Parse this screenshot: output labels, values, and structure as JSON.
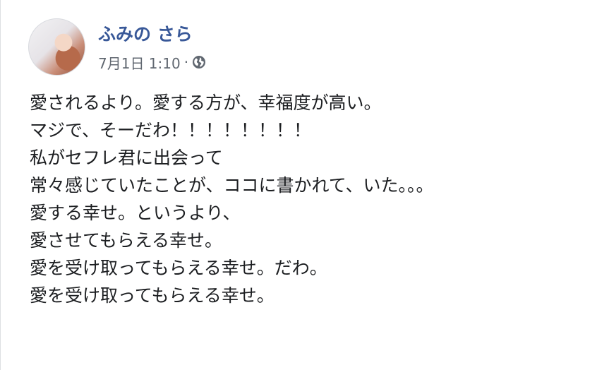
{
  "post": {
    "author_name": "ふみの さら",
    "timestamp": "7月1日 1:10",
    "separator": "·",
    "privacy_icon": "globe-icon",
    "lines": [
      "愛されるより。愛する方が、幸福度が高い。",
      "マジで、そーだわ！！！！！！！！",
      "私がセフレ君に出会って",
      "常々感じていたことが、ココに書かれて、いた。。。",
      "愛する幸せ。というより、",
      "愛させてもらえる幸せ。",
      "愛を受け取ってもらえる幸せ。だわ。",
      "愛を受け取ってもらえる幸せ。"
    ]
  },
  "colors": {
    "author": "#385898",
    "meta": "#606770",
    "text": "#1c1e21",
    "background": "#ffffff"
  }
}
